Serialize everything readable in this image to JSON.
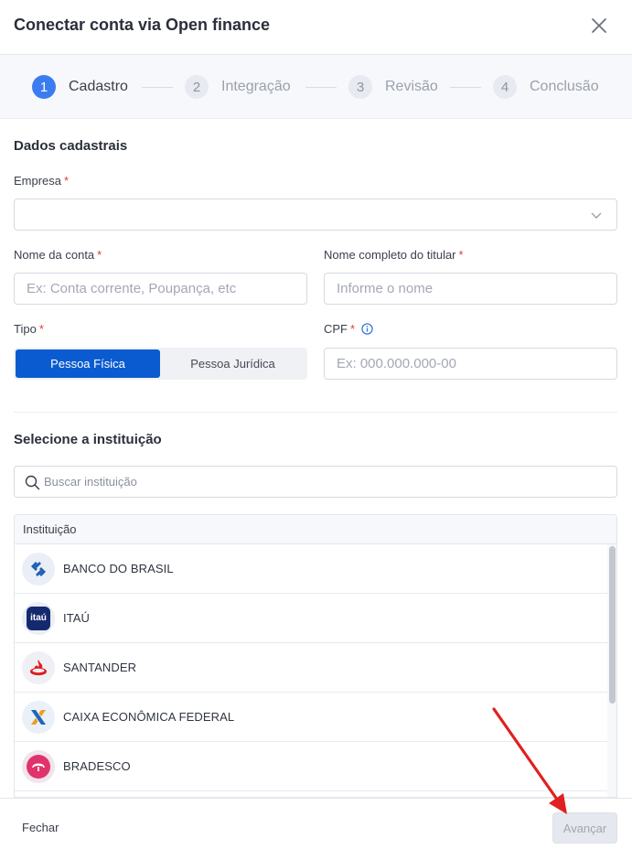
{
  "modal": {
    "title": "Conectar conta via Open finance"
  },
  "stepper": {
    "steps": [
      {
        "number": "1",
        "label": "Cadastro",
        "active": true
      },
      {
        "number": "2",
        "label": "Integração",
        "active": false
      },
      {
        "number": "3",
        "label": "Revisão",
        "active": false
      },
      {
        "number": "4",
        "label": "Conclusão",
        "active": false
      }
    ]
  },
  "form": {
    "section_title": "Dados cadastrais",
    "required_mark": "*",
    "empresa": {
      "label": "Empresa",
      "value": "",
      "placeholder": ""
    },
    "nome_conta": {
      "label": "Nome da conta",
      "placeholder": "Ex: Conta corrente, Poupança, etc"
    },
    "nome_titular": {
      "label": "Nome completo do titular",
      "placeholder": "Informe o nome"
    },
    "tipo": {
      "label": "Tipo",
      "options": [
        "Pessoa Física",
        "Pessoa Jurídica"
      ],
      "selected": "Pessoa Física"
    },
    "cpf": {
      "label": "CPF",
      "placeholder": "Ex: 000.000.000-00"
    }
  },
  "institution": {
    "section_title": "Selecione a instituição",
    "search_placeholder": "Buscar instituição",
    "column_header": "Instituição",
    "items": [
      {
        "label": "BANCO DO BRASIL",
        "icon": "banco-do-brasil-logo"
      },
      {
        "label": "ITAÚ",
        "icon": "itau-logo",
        "logo_text": "itaú"
      },
      {
        "label": "SANTANDER",
        "icon": "santander-logo"
      },
      {
        "label": "CAIXA ECONÔMICA FEDERAL",
        "icon": "caixa-logo"
      },
      {
        "label": "BRADESCO",
        "icon": "bradesco-logo"
      }
    ]
  },
  "footer": {
    "close_label": "Fechar",
    "next_label": "Avançar"
  },
  "colors": {
    "accent": "#0b5bd0",
    "step_active": "#3b7df0",
    "required": "#e23a3a",
    "annotation_arrow": "#e02020"
  }
}
